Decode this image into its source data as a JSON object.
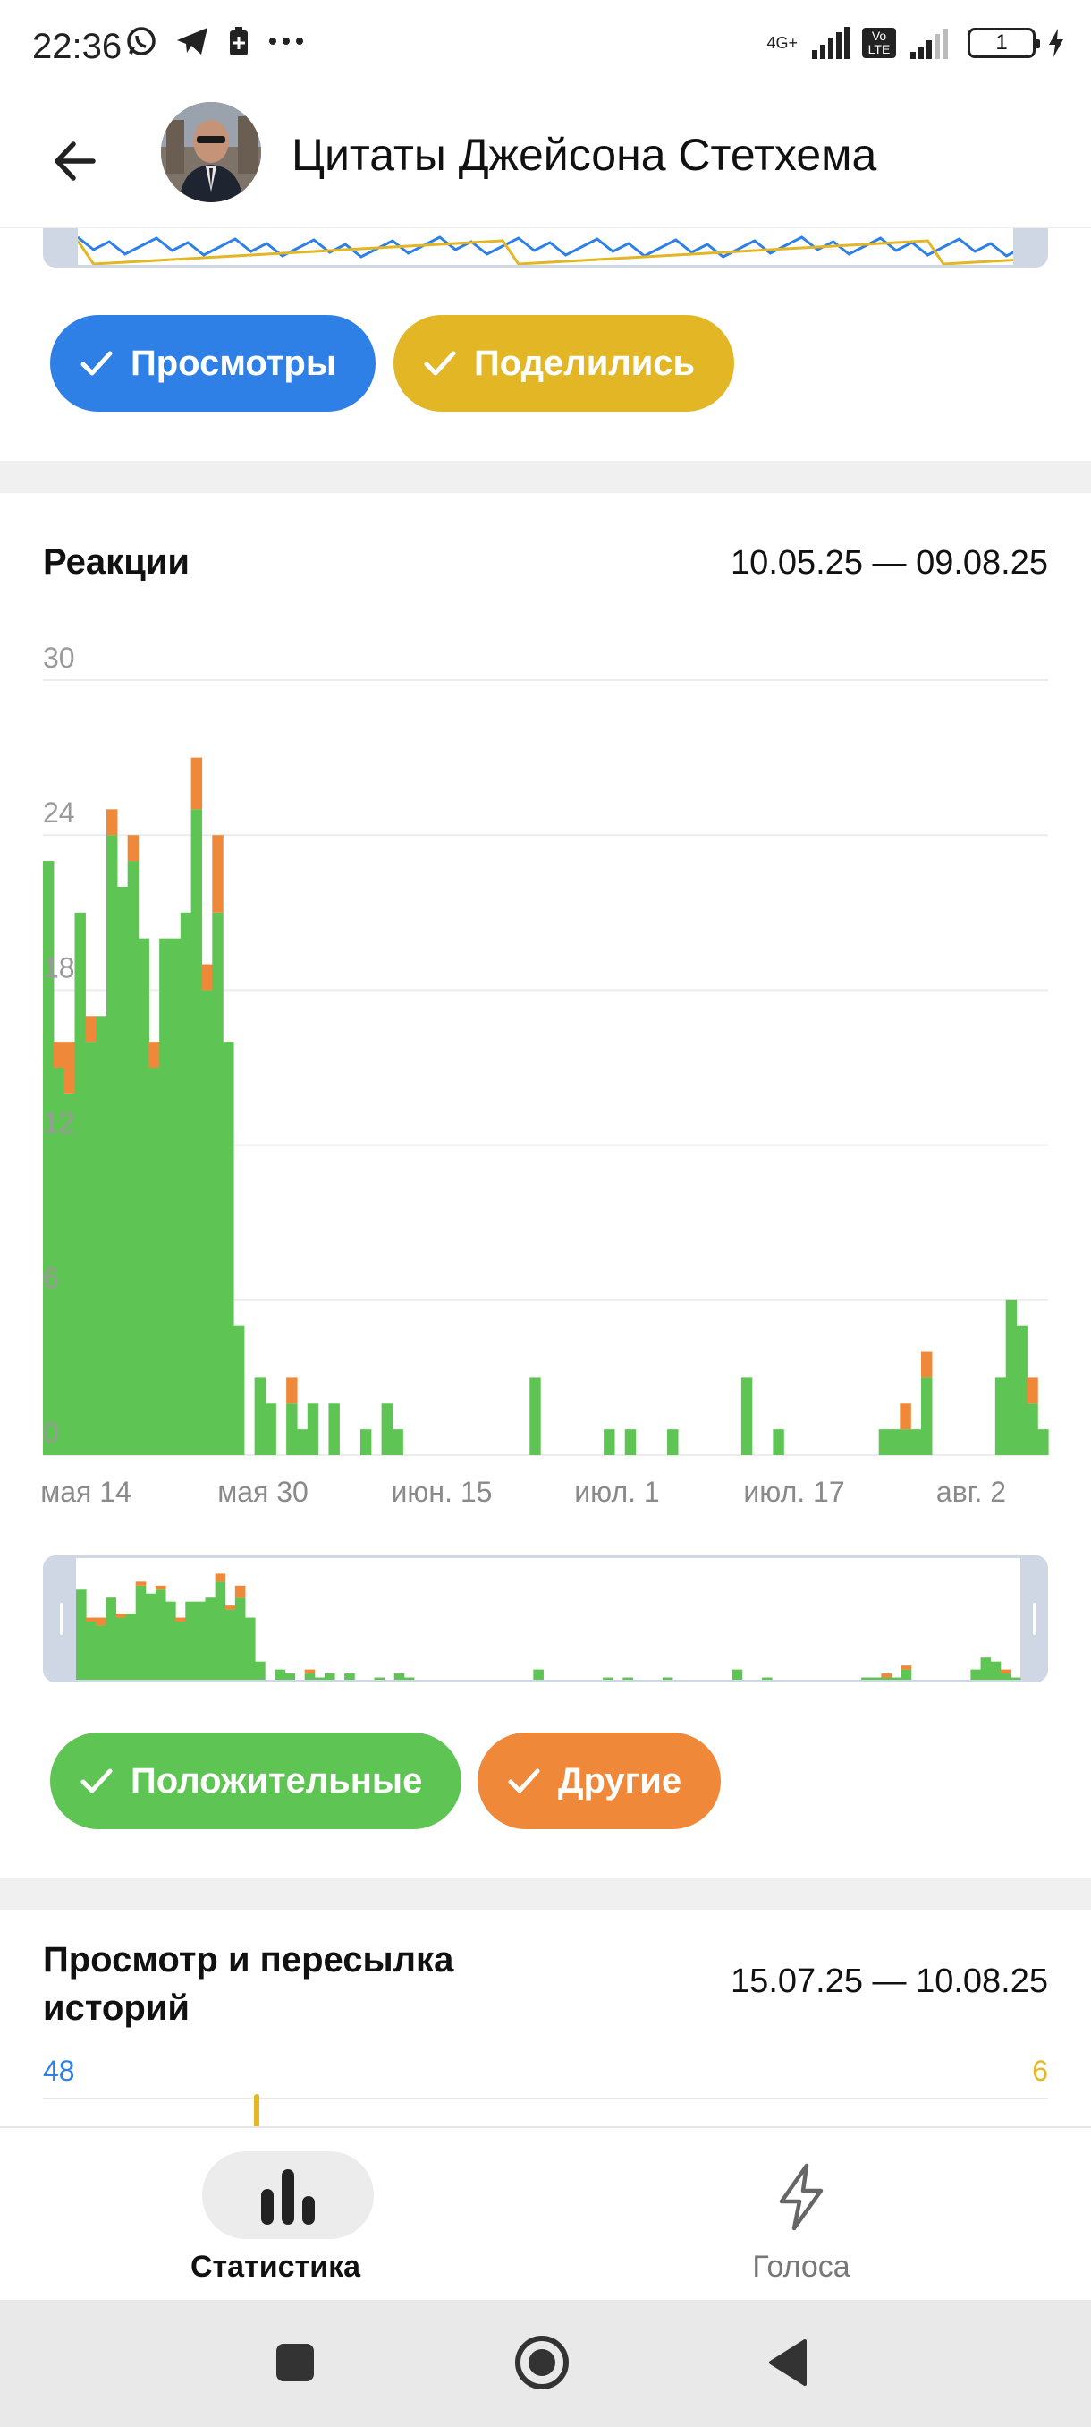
{
  "status_bar": {
    "time": "22:36",
    "network_label_1": "4G+",
    "network_label_2": "Vo LTE",
    "battery": "1",
    "icons": [
      "whatsapp-icon",
      "telegram-icon",
      "battery-saver-icon",
      "more-icon",
      "signal-icon",
      "signal-icon",
      "charging-icon"
    ]
  },
  "header": {
    "title": "Цитаты Джейсона Стетхема",
    "back_icon": "arrow-left-icon"
  },
  "views_chart": {
    "toggles": [
      {
        "label": "Просмотры",
        "color": "#2f80e6"
      },
      {
        "label": "Поделились",
        "color": "#e2b624"
      }
    ]
  },
  "reactions": {
    "title": "Реакции",
    "date_range": "10.05.25 — 09.08.25",
    "toggles": [
      {
        "label": "Положительные",
        "color": "#5ec453"
      },
      {
        "label": "Другие",
        "color": "#f0883a"
      }
    ]
  },
  "chart_data": {
    "type": "bar",
    "stacked": true,
    "title": "Реакции",
    "y_ticks": [
      "30",
      "24",
      "18",
      "12",
      "6",
      "0"
    ],
    "ylim": [
      0,
      30
    ],
    "x_ticks": [
      "мая 14",
      "мая 30",
      "июн. 15",
      "июл. 1",
      "июл. 17",
      "авг. 2"
    ],
    "grid": true,
    "series": [
      {
        "name": "Положительные",
        "color": "#5ec453",
        "values": [
          23,
          15,
          14,
          21,
          16,
          17,
          24,
          22,
          23,
          20,
          15,
          20,
          20,
          21,
          25,
          18,
          21,
          16,
          5,
          0,
          3,
          2,
          0,
          2,
          1,
          2,
          0,
          2,
          0,
          0,
          1,
          0,
          2,
          1,
          0,
          0,
          0,
          0,
          0,
          0,
          0,
          0,
          0,
          0,
          0,
          0,
          3,
          0,
          0,
          0,
          0,
          0,
          0,
          1,
          0,
          1,
          0,
          0,
          0,
          1,
          0,
          0,
          0,
          0,
          0,
          0,
          3,
          0,
          0,
          1,
          0,
          0,
          0,
          0,
          0,
          0,
          0,
          0,
          0,
          1,
          1,
          1,
          1,
          3,
          0,
          0,
          0,
          0,
          0,
          0,
          3,
          6,
          5,
          2,
          1
        ]
      },
      {
        "name": "Другие",
        "color": "#f0883a",
        "values": [
          0,
          1,
          2,
          0,
          1,
          0,
          1,
          0,
          1,
          0,
          1,
          0,
          0,
          0,
          2,
          1,
          3,
          0,
          0,
          0,
          0,
          0,
          0,
          1,
          0,
          0,
          0,
          0,
          0,
          0,
          0,
          0,
          0,
          0,
          0,
          0,
          0,
          0,
          0,
          0,
          0,
          0,
          0,
          0,
          0,
          0,
          0,
          0,
          0,
          0,
          0,
          0,
          0,
          0,
          0,
          0,
          0,
          0,
          0,
          0,
          0,
          0,
          0,
          0,
          0,
          0,
          0,
          0,
          0,
          0,
          0,
          0,
          0,
          0,
          0,
          0,
          0,
          0,
          0,
          0,
          0,
          1,
          0,
          1,
          0,
          0,
          0,
          0,
          0,
          0,
          0,
          0,
          0,
          1,
          0
        ]
      }
    ]
  },
  "stories": {
    "title_line1": "Просмотр и пересылка",
    "title_line2": "историй",
    "date_range": "15.07.25 — 10.08.25",
    "y_left_top": "48",
    "y_right_top": "6"
  },
  "bottom_nav": {
    "items": [
      {
        "label": "Статистика",
        "icon": "bar-chart-icon",
        "active": true
      },
      {
        "label": "Голоса",
        "icon": "lightning-icon",
        "active": false
      }
    ]
  },
  "system_nav": {
    "icons": [
      "square-icon",
      "circle-icon",
      "back-triangle-icon"
    ]
  }
}
